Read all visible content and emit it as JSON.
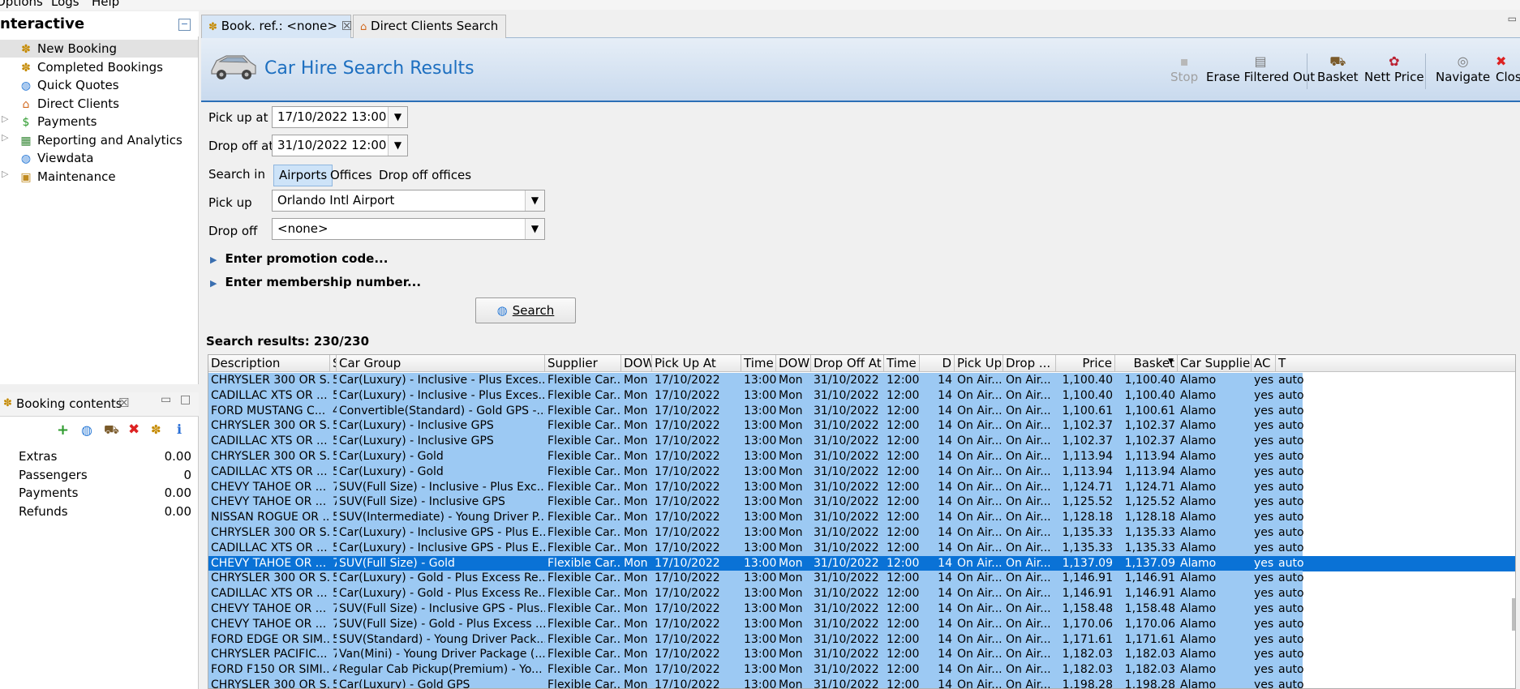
{
  "menu": [
    "Options",
    "Logs",
    "Help"
  ],
  "nav": {
    "title": "nteractive",
    "items": [
      {
        "label": "New Booking",
        "icon": "palm-tree-icon",
        "expandable": false,
        "selected": true
      },
      {
        "label": "Completed Bookings",
        "icon": "palm-tree-icon",
        "expandable": false
      },
      {
        "label": "Quick Quotes",
        "icon": "globe-icon",
        "expandable": false
      },
      {
        "label": "Direct Clients",
        "icon": "house-icon",
        "expandable": false
      },
      {
        "label": "Payments",
        "icon": "money-icon",
        "expandable": true
      },
      {
        "label": "Reporting and Analytics",
        "icon": "chart-icon",
        "expandable": true
      },
      {
        "label": "Viewdata",
        "icon": "globe-icon",
        "expandable": false
      },
      {
        "label": "Maintenance",
        "icon": "toolbox-icon",
        "expandable": true
      }
    ]
  },
  "booking": {
    "title": "Booking contents",
    "close": "☒",
    "toolbar_icons": [
      "add-icon",
      "globe-icon",
      "basket-icon",
      "delete-icon",
      "palm-tree-icon",
      "info-icon"
    ],
    "rows": [
      {
        "label": "Extras",
        "value": "0.00"
      },
      {
        "label": "Passengers",
        "value": "0"
      },
      {
        "label": "Payments",
        "value": "0.00"
      },
      {
        "label": "Refunds",
        "value": "0.00"
      }
    ]
  },
  "tabs": [
    {
      "label": "Book. ref.: <none>",
      "close": "☒",
      "active": true
    },
    {
      "label": "Direct Clients Search",
      "active": false
    }
  ],
  "header": {
    "title": "Car Hire Search Results",
    "toolbar": [
      {
        "label": "Stop",
        "icon": "stop-icon",
        "disabled": true
      },
      {
        "label": "Erase Filtered Out",
        "icon": "erase-icon",
        "disabled": false
      },
      {
        "label": "Basket",
        "icon": "basket-icon",
        "disabled": false
      },
      {
        "label": "Nett Price",
        "icon": "price-icon",
        "disabled": false
      },
      {
        "label": "Navigate",
        "icon": "navigate-icon",
        "disabled": false
      },
      {
        "label": "Clos",
        "icon": "close-icon",
        "disabled": false
      }
    ]
  },
  "form": {
    "pickup_at_label": "Pick up at",
    "pickup_at_value": "17/10/2022 13:00",
    "dropoff_at_label": "Drop off at",
    "dropoff_at_value": "31/10/2022 12:00",
    "search_in_label": "Search in",
    "search_in_options": [
      "Airports",
      "Offices",
      "Drop off offices"
    ],
    "search_in_selected": "Airports",
    "pickup_label": "Pick up",
    "pickup_value": "Orlando Intl Airport",
    "dropoff_label": "Drop off",
    "dropoff_value": "<none>",
    "promo_label": "Enter promotion code...",
    "membership_label": "Enter membership number...",
    "search_button": "Search"
  },
  "results": {
    "count_label": "Search results: 230/230",
    "columns": [
      "Description",
      "S",
      "Car Group",
      "Supplier",
      "DOW",
      "Pick Up At",
      "Time",
      "DOW",
      "Drop Off At",
      "Time",
      "D",
      "Pick Up",
      "Drop ...",
      "Price",
      "Basket",
      "Car Supplier",
      "AC",
      "T"
    ],
    "sort_column": "Basket",
    "rows": [
      [
        "CHRYSLER 300 OR S...",
        "5",
        "Car(Luxury) - Inclusive - Plus Exces...",
        "Flexible Car...",
        "Mon",
        "17/10/2022",
        "13:00",
        "Mon",
        "31/10/2022",
        "12:00",
        "14",
        "On Air...",
        "On Air...",
        "1,100.40",
        "1,100.40",
        "Alamo",
        "yes",
        "auto"
      ],
      [
        "CADILLAC XTS OR ...",
        "5",
        "Car(Luxury) - Inclusive - Plus Exces...",
        "Flexible Car...",
        "Mon",
        "17/10/2022",
        "13:00",
        "Mon",
        "31/10/2022",
        "12:00",
        "14",
        "On Air...",
        "On Air...",
        "1,100.40",
        "1,100.40",
        "Alamo",
        "yes",
        "auto"
      ],
      [
        "FORD MUSTANG C...",
        "4",
        "Convertible(Standard) - Gold GPS -...",
        "Flexible Car...",
        "Mon",
        "17/10/2022",
        "13:00",
        "Mon",
        "31/10/2022",
        "12:00",
        "14",
        "On Air...",
        "On Air...",
        "1,100.61",
        "1,100.61",
        "Alamo",
        "yes",
        "auto"
      ],
      [
        "CHRYSLER 300 OR S...",
        "5",
        "Car(Luxury) - Inclusive GPS",
        "Flexible Car...",
        "Mon",
        "17/10/2022",
        "13:00",
        "Mon",
        "31/10/2022",
        "12:00",
        "14",
        "On Air...",
        "On Air...",
        "1,102.37",
        "1,102.37",
        "Alamo",
        "yes",
        "auto"
      ],
      [
        "CADILLAC XTS OR ...",
        "5",
        "Car(Luxury) - Inclusive GPS",
        "Flexible Car...",
        "Mon",
        "17/10/2022",
        "13:00",
        "Mon",
        "31/10/2022",
        "12:00",
        "14",
        "On Air...",
        "On Air...",
        "1,102.37",
        "1,102.37",
        "Alamo",
        "yes",
        "auto"
      ],
      [
        "CHRYSLER 300 OR S...",
        "5",
        "Car(Luxury) - Gold",
        "Flexible Car...",
        "Mon",
        "17/10/2022",
        "13:00",
        "Mon",
        "31/10/2022",
        "12:00",
        "14",
        "On Air...",
        "On Air...",
        "1,113.94",
        "1,113.94",
        "Alamo",
        "yes",
        "auto"
      ],
      [
        "CADILLAC XTS OR ...",
        "5",
        "Car(Luxury) - Gold",
        "Flexible Car...",
        "Mon",
        "17/10/2022",
        "13:00",
        "Mon",
        "31/10/2022",
        "12:00",
        "14",
        "On Air...",
        "On Air...",
        "1,113.94",
        "1,113.94",
        "Alamo",
        "yes",
        "auto"
      ],
      [
        "CHEVY TAHOE OR ...",
        "7",
        "SUV(Full Size) - Inclusive - Plus Exc...",
        "Flexible Car...",
        "Mon",
        "17/10/2022",
        "13:00",
        "Mon",
        "31/10/2022",
        "12:00",
        "14",
        "On Air...",
        "On Air...",
        "1,124.71",
        "1,124.71",
        "Alamo",
        "yes",
        "auto"
      ],
      [
        "CHEVY TAHOE OR ...",
        "7",
        "SUV(Full Size) - Inclusive GPS",
        "Flexible Car...",
        "Mon",
        "17/10/2022",
        "13:00",
        "Mon",
        "31/10/2022",
        "12:00",
        "14",
        "On Air...",
        "On Air...",
        "1,125.52",
        "1,125.52",
        "Alamo",
        "yes",
        "auto"
      ],
      [
        "NISSAN ROGUE OR ...",
        "5",
        "SUV(Intermediate) - Young Driver P...",
        "Flexible Car...",
        "Mon",
        "17/10/2022",
        "13:00",
        "Mon",
        "31/10/2022",
        "12:00",
        "14",
        "On Air...",
        "On Air...",
        "1,128.18",
        "1,128.18",
        "Alamo",
        "yes",
        "auto"
      ],
      [
        "CHRYSLER 300 OR S...",
        "5",
        "Car(Luxury) - Inclusive GPS - Plus E...",
        "Flexible Car...",
        "Mon",
        "17/10/2022",
        "13:00",
        "Mon",
        "31/10/2022",
        "12:00",
        "14",
        "On Air...",
        "On Air...",
        "1,135.33",
        "1,135.33",
        "Alamo",
        "yes",
        "auto"
      ],
      [
        "CADILLAC XTS OR ...",
        "5",
        "Car(Luxury) - Inclusive GPS - Plus E...",
        "Flexible Car...",
        "Mon",
        "17/10/2022",
        "13:00",
        "Mon",
        "31/10/2022",
        "12:00",
        "14",
        "On Air...",
        "On Air...",
        "1,135.33",
        "1,135.33",
        "Alamo",
        "yes",
        "auto"
      ],
      [
        "CHEVY TAHOE OR ...",
        "7",
        "SUV(Full Size) - Gold",
        "Flexible Car...",
        "Mon",
        "17/10/2022",
        "13:00",
        "Mon",
        "31/10/2022",
        "12:00",
        "14",
        "On Air...",
        "On Air...",
        "1,137.09",
        "1,137.09",
        "Alamo",
        "yes",
        "auto"
      ],
      [
        "CHRYSLER 300 OR S...",
        "5",
        "Car(Luxury) - Gold - Plus Excess Re...",
        "Flexible Car...",
        "Mon",
        "17/10/2022",
        "13:00",
        "Mon",
        "31/10/2022",
        "12:00",
        "14",
        "On Air...",
        "On Air...",
        "1,146.91",
        "1,146.91",
        "Alamo",
        "yes",
        "auto"
      ],
      [
        "CADILLAC XTS OR ...",
        "5",
        "Car(Luxury) - Gold - Plus Excess Re...",
        "Flexible Car...",
        "Mon",
        "17/10/2022",
        "13:00",
        "Mon",
        "31/10/2022",
        "12:00",
        "14",
        "On Air...",
        "On Air...",
        "1,146.91",
        "1,146.91",
        "Alamo",
        "yes",
        "auto"
      ],
      [
        "CHEVY TAHOE OR ...",
        "7",
        "SUV(Full Size) - Inclusive GPS - Plus...",
        "Flexible Car...",
        "Mon",
        "17/10/2022",
        "13:00",
        "Mon",
        "31/10/2022",
        "12:00",
        "14",
        "On Air...",
        "On Air...",
        "1,158.48",
        "1,158.48",
        "Alamo",
        "yes",
        "auto"
      ],
      [
        "CHEVY TAHOE OR ...",
        "7",
        "SUV(Full Size) - Gold - Plus Excess ...",
        "Flexible Car...",
        "Mon",
        "17/10/2022",
        "13:00",
        "Mon",
        "31/10/2022",
        "12:00",
        "14",
        "On Air...",
        "On Air...",
        "1,170.06",
        "1,170.06",
        "Alamo",
        "yes",
        "auto"
      ],
      [
        "FORD EDGE OR SIM...",
        "5",
        "SUV(Standard) - Young Driver Pack...",
        "Flexible Car...",
        "Mon",
        "17/10/2022",
        "13:00",
        "Mon",
        "31/10/2022",
        "12:00",
        "14",
        "On Air...",
        "On Air...",
        "1,171.61",
        "1,171.61",
        "Alamo",
        "yes",
        "auto"
      ],
      [
        "CHRYSLER PACIFIC...",
        "7",
        "Van(Mini) - Young Driver Package (...",
        "Flexible Car...",
        "Mon",
        "17/10/2022",
        "13:00",
        "Mon",
        "31/10/2022",
        "12:00",
        "14",
        "On Air...",
        "On Air...",
        "1,182.03",
        "1,182.03",
        "Alamo",
        "yes",
        "auto"
      ],
      [
        "FORD F150 OR SIMI...",
        "4",
        "Regular Cab Pickup(Premium) - Yo...",
        "Flexible Car...",
        "Mon",
        "17/10/2022",
        "13:00",
        "Mon",
        "31/10/2022",
        "12:00",
        "14",
        "On Air...",
        "On Air...",
        "1,182.03",
        "1,182.03",
        "Alamo",
        "yes",
        "auto"
      ],
      [
        "CHRYSLER 300 OR S...",
        "5",
        "Car(Luxury) - Gold GPS",
        "Flexible Car...",
        "Mon",
        "17/10/2022",
        "13:00",
        "Mon",
        "31/10/2022",
        "12:00",
        "14",
        "On Air...",
        "On Air...",
        "1,198.28",
        "1,198.28",
        "Alamo",
        "yes",
        "auto"
      ]
    ],
    "selected_row": 12
  },
  "colors": {
    "row_bg": "#9cc9f3",
    "row_selected": "#0a72d6",
    "title_blue": "#1d6fc0"
  }
}
